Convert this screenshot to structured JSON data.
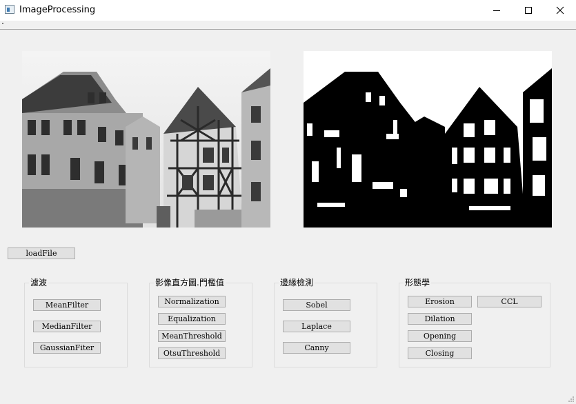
{
  "window": {
    "title": "ImageProcessing",
    "icon": "app-window-icon",
    "controls": [
      "minimize-icon",
      "maximize-icon",
      "close-icon"
    ]
  },
  "images": {
    "left": "original-grayscale-photo",
    "right": "binary-threshold-result"
  },
  "load_button": "loadFile",
  "groups": [
    {
      "label": "濾波",
      "buttons": [
        "MeanFilter",
        "MedianFilter",
        "GaussianFiter"
      ]
    },
    {
      "label": "影像直方圖.門檻值",
      "buttons": [
        "Normalization",
        "Equalization",
        "MeanThreshold",
        "OtsuThreshold"
      ]
    },
    {
      "label": "邊緣檢測",
      "buttons": [
        "Sobel",
        "Laplace",
        "Canny"
      ]
    },
    {
      "label": "形態學",
      "buttons": [
        "Erosion",
        "Dilation",
        "Opening",
        "Closing",
        "CCL"
      ]
    }
  ]
}
